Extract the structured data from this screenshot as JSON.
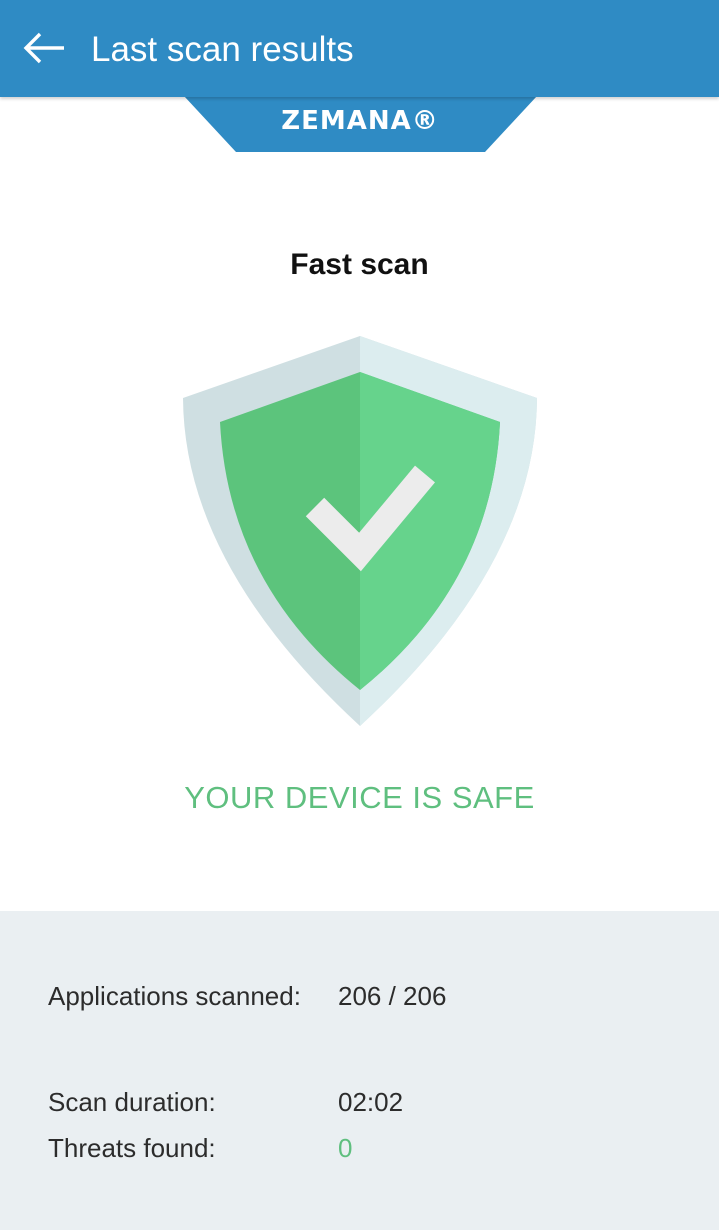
{
  "header": {
    "title": "Last scan results",
    "back_icon": "arrow-left-icon"
  },
  "brand": {
    "logo_text": "ZEMANA®"
  },
  "scan": {
    "name": "Fast scan",
    "status": "YOUR DEVICE IS SAFE",
    "icon": "shield-check-icon"
  },
  "stats": {
    "apps_label": "Applications scanned:",
    "apps_value": "206 / 206",
    "duration_label": "Scan duration:",
    "duration_value": "02:02",
    "threats_label": "Threats found:",
    "threats_value": "0"
  },
  "colors": {
    "header_bg": "#2f8bc4",
    "safe_green": "#5fbf7f",
    "panel_bg": "#eaeff2"
  }
}
